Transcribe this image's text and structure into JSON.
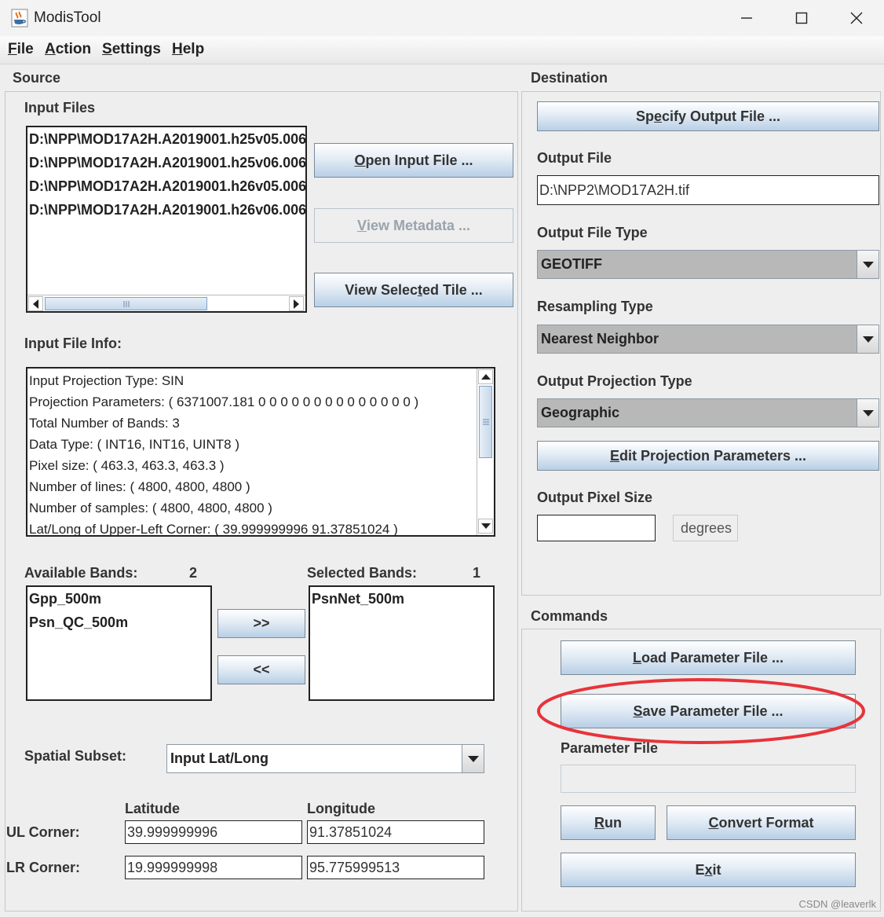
{
  "window": {
    "title": "ModisTool",
    "icons": {
      "app": "java-cup-icon",
      "minimize": "minimize-icon",
      "maximize": "maximize-icon",
      "close": "close-icon"
    }
  },
  "menu": [
    {
      "mnemonic": "F",
      "rest": "ile"
    },
    {
      "mnemonic": "A",
      "rest": "ction"
    },
    {
      "mnemonic": "S",
      "rest": "ettings"
    },
    {
      "mnemonic": "H",
      "rest": "elp"
    }
  ],
  "source": {
    "header": "Source",
    "input_files_label": "Input Files",
    "input_files": [
      "D:\\NPP\\MOD17A2H.A2019001.h25v05.006.",
      "D:\\NPP\\MOD17A2H.A2019001.h25v06.006.",
      "D:\\NPP\\MOD17A2H.A2019001.h26v05.006.",
      "D:\\NPP\\MOD17A2H.A2019001.h26v06.006."
    ],
    "open_input_btn": {
      "mnemonic": "O",
      "rest": "pen Input File ..."
    },
    "view_metadata_btn": {
      "mnemonic": "V",
      "rest": "iew Metadata ..."
    },
    "view_tile_btn": {
      "before": "View Selec",
      "mnemonic": "t",
      "after": "ed Tile   ..."
    },
    "input_file_info_label": "Input File Info:",
    "info_lines": [
      "Input Projection Type: SIN",
      "Projection Parameters: ( 6371007.181 0 0 0 0 0 0 0 0 0 0 0 0 0 0 )",
      "Total Number of Bands: 3",
      "Data Type: ( INT16, INT16, UINT8 )",
      "Pixel size: ( 463.3, 463.3, 463.3 )",
      "Number of lines: ( 4800, 4800, 4800 )",
      "Number of samples: ( 4800, 4800, 4800 )",
      "Lat/Long of Upper-Left Corner: ( 39.999999996 91.37851024 )"
    ],
    "available_bands_label": "Available Bands:",
    "available_bands_count": "2",
    "available_bands": [
      "Gpp_500m",
      "Psn_QC_500m"
    ],
    "selected_bands_label": "Selected Bands:",
    "selected_bands_count": "1",
    "selected_bands": [
      "PsnNet_500m"
    ],
    "add_btn": ">>",
    "remove_btn": "<<",
    "spatial_subset_label": "Spatial Subset:",
    "spatial_subset_value": "Input Lat/Long",
    "latitude_label": "Latitude",
    "longitude_label": "Longitude",
    "ul_label": "UL Corner:",
    "lr_label": "LR Corner:",
    "ul_lat": "39.999999996",
    "ul_lon": "91.37851024",
    "lr_lat": "19.999999998",
    "lr_lon": "95.775999513"
  },
  "destination": {
    "header": "Destination",
    "specify_output_btn": {
      "before": "Sp",
      "mnemonic": "e",
      "after": "cify Output File ..."
    },
    "output_file_label": "Output File",
    "output_file_value": "D:\\NPP2\\MOD17A2H.tif",
    "output_file_type_label": "Output File Type",
    "output_file_type_value": "GEOTIFF",
    "resampling_type_label": "Resampling Type",
    "resampling_type_value": "Nearest Neighbor",
    "output_projection_label": "Output Projection Type",
    "output_projection_value": "Geographic",
    "edit_projection_btn": {
      "mnemonic": "E",
      "rest": "dit Projection Parameters ..."
    },
    "output_pixel_size_label": "Output Pixel Size",
    "output_pixel_size_value": "",
    "pixel_unit": "degrees"
  },
  "commands": {
    "header": "Commands",
    "load_btn": {
      "mnemonic": "L",
      "rest": "oad Parameter File ..."
    },
    "save_btn": {
      "mnemonic": "S",
      "rest": "ave Parameter File ..."
    },
    "parameter_file_label": "Parameter File",
    "parameter_file_value": "",
    "run_btn": {
      "mnemonic": "R",
      "rest": "un"
    },
    "convert_btn": {
      "mnemonic": "C",
      "rest": "onvert Format"
    },
    "exit_btn": {
      "before": "E",
      "mnemonic": "x",
      "after": "it"
    },
    "highlight_color": "#e8333a"
  },
  "watermark": "CSDN @leaverlk"
}
